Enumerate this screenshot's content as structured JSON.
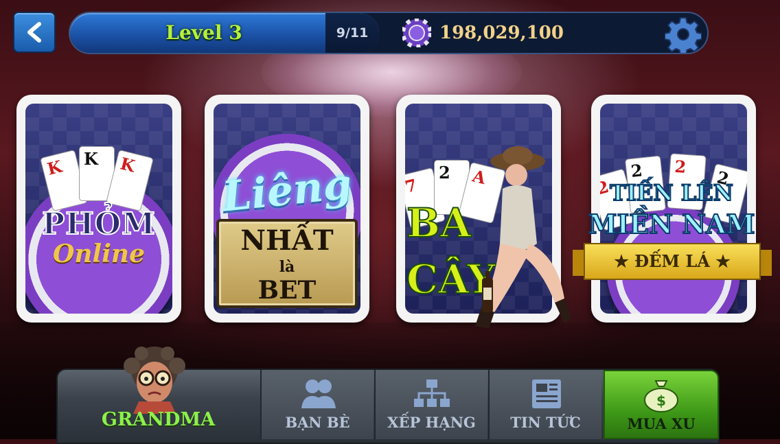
{
  "header": {
    "back_label": "",
    "level": "Level 3",
    "xp": "9/11",
    "coins": "198,029,100"
  },
  "games": [
    {
      "name_line1": "PHỎM",
      "name_line2": "Online"
    },
    {
      "name_line1": "Liêng",
      "board_line1": "NHẤT",
      "board_line2": "là",
      "board_line3": "BET"
    },
    {
      "name_line1": "BA",
      "name_line2": "CÂY"
    },
    {
      "name_line1": "TIẾN LÊN",
      "name_line2": "MIỀN NAM",
      "ribbon": "★ ĐẾM LÁ ★"
    }
  ],
  "player": {
    "name": "GRANDMA"
  },
  "nav": [
    {
      "label": "BẠN BÈ",
      "icon": "friends-icon"
    },
    {
      "label": "XẾP HẠNG",
      "icon": "ranking-icon"
    },
    {
      "label": "TIN TỨC",
      "icon": "news-icon"
    },
    {
      "label": "MUA XU",
      "icon": "money-bag-icon"
    }
  ],
  "colors": {
    "level_text": "#b6f03a",
    "coins_text": "#f2d28a",
    "player_name": "#8cf04a",
    "active_nav": "#5bb526"
  }
}
